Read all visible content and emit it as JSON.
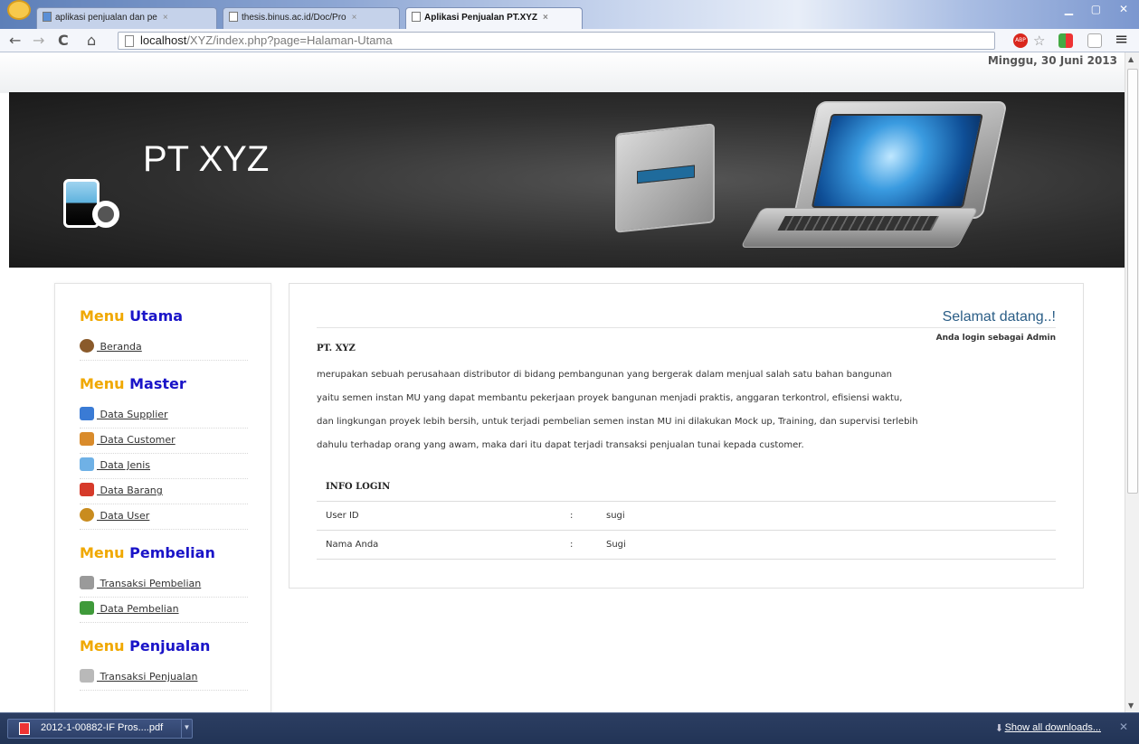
{
  "browser": {
    "tabs": [
      {
        "label": "aplikasi penjualan dan pe",
        "active": false
      },
      {
        "label": "thesis.binus.ac.id/Doc/Pro",
        "active": false
      },
      {
        "label": "Aplikasi Penjualan PT.XYZ",
        "active": true
      }
    ],
    "tab_close": "×",
    "url_host": "localhost",
    "url_path": "/XYZ/index.php?page=Halaman-Utama",
    "nav": {
      "back": "←",
      "forward": "→",
      "reload": "C",
      "home": "⌂"
    },
    "extensions": {
      "abp": "ABP",
      "star": "☆",
      "menu": "≡"
    }
  },
  "page": {
    "date": "Minggu, 30 Juni 2013",
    "brand": "PT XYZ",
    "sidebar": {
      "blocks": [
        {
          "title_a": "Menu ",
          "title_b": "Utama",
          "items": [
            {
              "label": " Beranda",
              "icon": "home-icon",
              "color": "#8a5a2b"
            }
          ]
        },
        {
          "title_a": "Menu ",
          "title_b": "Master",
          "items": [
            {
              "label": " Data Supplier",
              "icon": "supplier-icon",
              "color": "#3a7bd5"
            },
            {
              "label": " Data Customer",
              "icon": "customer-icon",
              "color": "#d98b2b"
            },
            {
              "label": " Data Jenis",
              "icon": "jenis-icon",
              "color": "#6fb1e6"
            },
            {
              "label": " Data Barang",
              "icon": "barang-icon",
              "color": "#d63a2a"
            },
            {
              "label": " Data User",
              "icon": "user-icon",
              "color": "#c98c1f"
            }
          ]
        },
        {
          "title_a": "Menu ",
          "title_b": "Pembelian",
          "items": [
            {
              "label": " Transaksi Pembelian",
              "icon": "transaksi-pembelian-icon",
              "color": "#9a9a9a"
            },
            {
              "label": " Data Pembelian",
              "icon": "data-pembelian-icon",
              "color": "#3f9a3a"
            }
          ]
        },
        {
          "title_a": "Menu ",
          "title_b": "Penjualan",
          "items": [
            {
              "label": " Transaksi Penjualan",
              "icon": "transaksi-penjualan-icon",
              "color": "#b9b9b9"
            }
          ]
        }
      ]
    },
    "content": {
      "welcome": "Selamat datang..!",
      "login_as": "Anda login sebagai Admin",
      "company": "PT. XYZ",
      "description_lines": [
        "merupakan sebuah perusahaan distributor di bidang pembangunan yang bergerak dalam menjual salah satu bahan bangunan",
        "yaitu semen instan MU yang dapat membantu pekerjaan proyek bangunan menjadi praktis, anggaran terkontrol, efisiensi waktu,",
        "dan lingkungan proyek lebih bersih, untuk terjadi pembelian semen instan MU ini dilakukan Mock up, Training, dan supervisi terlebih",
        "dahulu terhadap orang yang awam, maka dari itu dapat terjadi transaksi penjualan tunai kepada customer."
      ],
      "info_title": "INFO LOGIN",
      "info_rows": [
        {
          "label": "User ID",
          "sep": ":",
          "value": "sugi"
        },
        {
          "label": "Nama Anda",
          "sep": ":",
          "value": "Sugi"
        }
      ]
    }
  },
  "downloads": {
    "file": "2012-1-00882-IF Pros....pdf",
    "show_all": "Show all downloads...",
    "close": "✕"
  }
}
